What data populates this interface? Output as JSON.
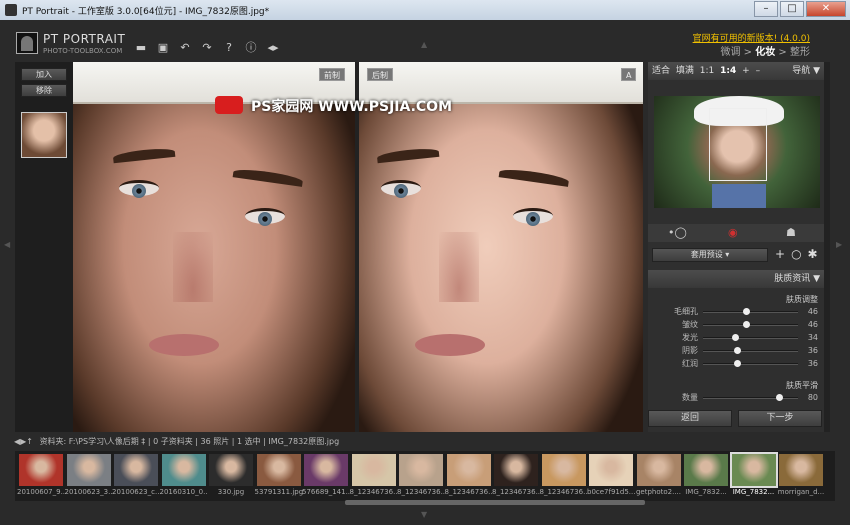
{
  "window": {
    "title": "PT Portrait - 工作室版 3.0.0[64位元] - IMG_7832原图.jpg*",
    "minimize": "–",
    "maximize": "□",
    "close": "✕"
  },
  "header": {
    "logo_main": "PT PORTRAIT",
    "logo_sub": "PHOTO-TOOLBOX.COM",
    "update_link": "官网有可用的新版本! (4.0.0)",
    "workflow": {
      "step1": "微调",
      "sep1": " > ",
      "step2": "化妆",
      "sep2": " > ",
      "step3": "整形"
    },
    "toolbar_icons": [
      "open-folder-icon",
      "save-icon",
      "undo-icon",
      "redo-icon",
      "help-icon",
      "info-icon",
      "plugin-icon"
    ]
  },
  "left_panel": {
    "add_label": "加入",
    "remove_label": "移除"
  },
  "viewer": {
    "before_label": "前制",
    "after_label": "后制",
    "a_label": "A",
    "watermark": "PS家园网   WWW.PSJIA.COM"
  },
  "navigator": {
    "fit": "适合",
    "fill": "填满",
    "one_to_one": "1:1",
    "one_to_four": "1:4",
    "plus": "+",
    "minus": "–",
    "title": "导航"
  },
  "presets": {
    "label": "套用预设"
  },
  "skin_panel": {
    "title": "肤质资讯",
    "group1_title": "肤质调整",
    "sliders1": [
      {
        "label": "毛细孔",
        "value": "46",
        "fraction": 0.46
      },
      {
        "label": "皱纹",
        "value": "46",
        "fraction": 0.46
      },
      {
        "label": "发光",
        "value": "34",
        "fraction": 0.34
      },
      {
        "label": "阴影",
        "value": "36",
        "fraction": 0.36
      },
      {
        "label": "红润",
        "value": "36",
        "fraction": 0.36
      }
    ],
    "group2_title": "肤质平滑",
    "sliders2": [
      {
        "label": "数量",
        "value": "80",
        "fraction": 0.8
      }
    ]
  },
  "buttons": {
    "back": "返回",
    "next": "下一步"
  },
  "pathbar": {
    "text": "资料夹: F:\\PS学习\\人像后期 ‡ | 0 子资料夹 | 36 照片 | 1 选中 | IMG_7832原图.jpg"
  },
  "filmstrip": {
    "items": [
      {
        "name": "20100607_9...",
        "color": "#b0342a"
      },
      {
        "name": "20100623_3...",
        "color": "#7b7f84"
      },
      {
        "name": "20100623_c...",
        "color": "#4a4e58"
      },
      {
        "name": "20160310_0...",
        "color": "#4f8c8c"
      },
      {
        "name": "330.jpg",
        "color": "#2c2c2c"
      },
      {
        "name": "53791311.jpg",
        "color": "#8a5a40"
      },
      {
        "name": "576689_141...",
        "color": "#6a3a68"
      },
      {
        "name": "8_12346736...",
        "color": "#d6c6a8"
      },
      {
        "name": "8_12346736...",
        "color": "#b8a28c"
      },
      {
        "name": "8_12346736...",
        "color": "#c89e78"
      },
      {
        "name": "8_12346736...",
        "color": "#2e221e"
      },
      {
        "name": "8_12346736...",
        "color": "#c89860"
      },
      {
        "name": "b0ce7f91d5...",
        "color": "#e6d2b8"
      },
      {
        "name": "getphoto2....",
        "color": "#a88466"
      },
      {
        "name": "IMG_7832...",
        "color": "#5a7a4a"
      },
      {
        "name": "IMG_7832...",
        "color": "#6a8a52"
      },
      {
        "name": "morrigan_d...",
        "color": "#8a6a3a"
      }
    ]
  }
}
